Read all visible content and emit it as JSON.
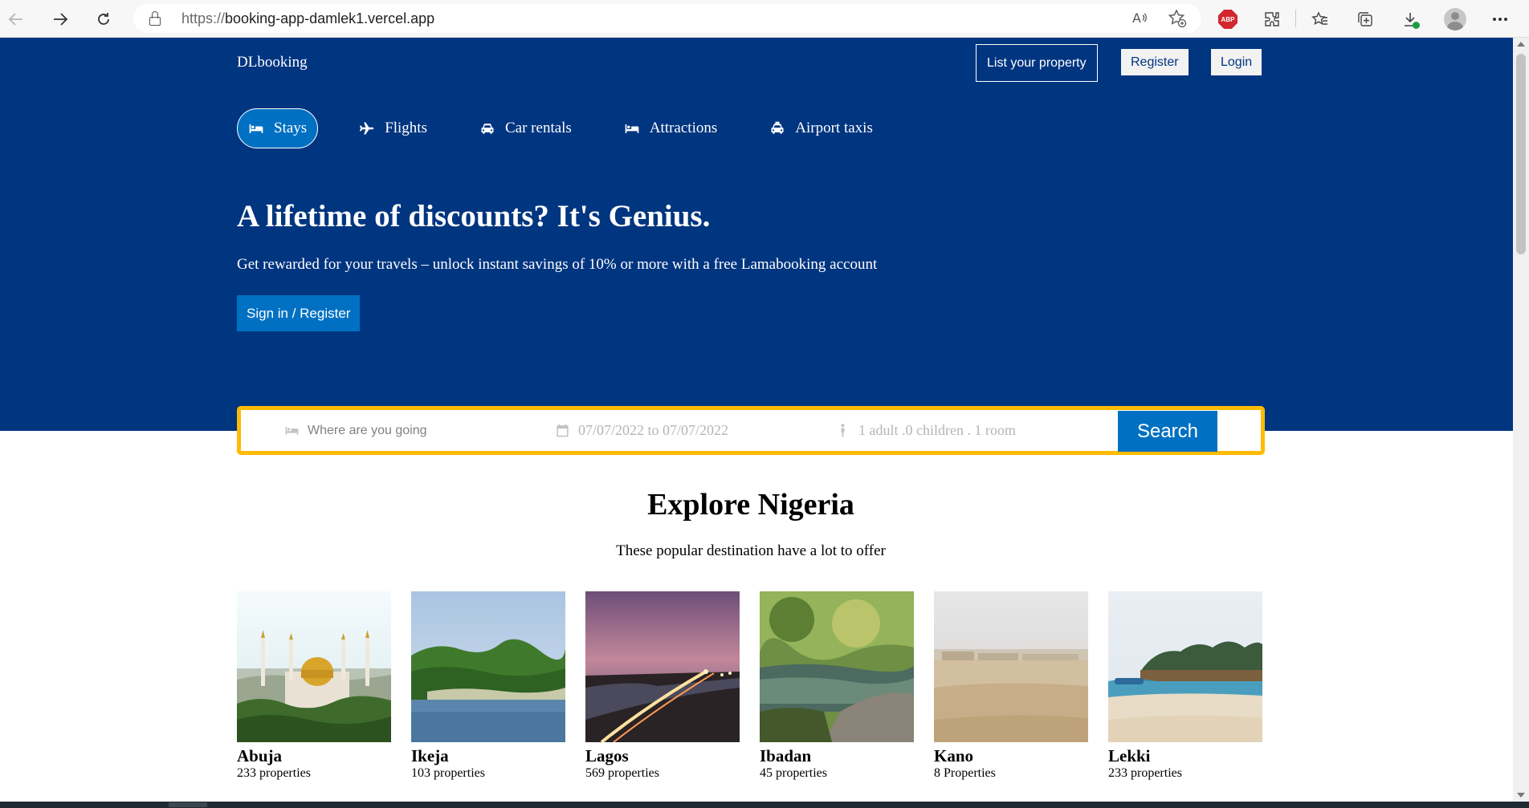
{
  "browser": {
    "url_protocol": "https://",
    "url_host": "booking-app-damlek1.vercel.app",
    "abp_label": "ABP"
  },
  "header": {
    "logo": "DLbooking",
    "list_property": "List your property",
    "register": "Register",
    "login": "Login"
  },
  "nav": {
    "tabs": [
      {
        "label": "Stays",
        "icon": "bed-icon",
        "active": true
      },
      {
        "label": "Flights",
        "icon": "plane-icon",
        "active": false
      },
      {
        "label": "Car rentals",
        "icon": "car-icon",
        "active": false
      },
      {
        "label": "Attractions",
        "icon": "bed-icon",
        "active": false
      },
      {
        "label": "Airport taxis",
        "icon": "taxi-icon",
        "active": false
      }
    ]
  },
  "hero": {
    "title": "A lifetime of discounts? It's Genius.",
    "subtitle": "Get rewarded for your travels – unlock instant savings of 10% or more with a free Lamabooking account",
    "signin_button": "Sign in / Register"
  },
  "search": {
    "destination_placeholder": "Where are you going",
    "dates": "07/07/2022 to 07/07/2022",
    "guests": "1 adult .0 children . 1 room",
    "button": "Search"
  },
  "explore": {
    "title": "Explore Nigeria",
    "subtitle": "These popular destination have a lot to offer",
    "cities": [
      {
        "name": "Abuja",
        "count": "233 properties"
      },
      {
        "name": "Ikeja",
        "count": "103 properties"
      },
      {
        "name": "Lagos",
        "count": "569 properties"
      },
      {
        "name": "Ibadan",
        "count": "45 properties"
      },
      {
        "name": "Kano",
        "count": "8 Properties"
      },
      {
        "name": "Lekki",
        "count": "233 properties"
      }
    ]
  },
  "colors": {
    "brand_blue": "#003580",
    "action_blue": "#0071c2",
    "search_border": "#febb02"
  }
}
